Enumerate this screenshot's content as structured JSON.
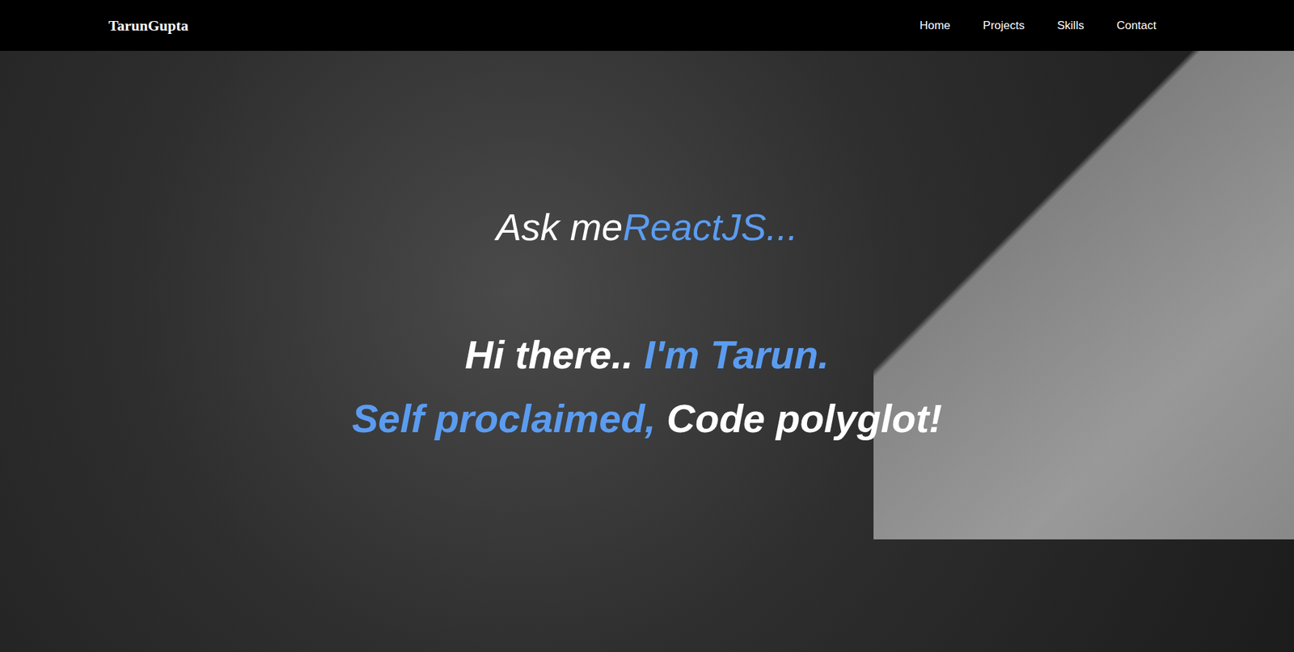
{
  "navbar": {
    "brand": "TarunGupta",
    "links": [
      {
        "label": "Home"
      },
      {
        "label": "Projects"
      },
      {
        "label": "Skills"
      },
      {
        "label": "Contact"
      }
    ]
  },
  "hero": {
    "typing": {
      "prefix": "Ask me",
      "word": "ReactJS..."
    },
    "lines": [
      [
        {
          "text": "Hi there.. ",
          "accent": false
        },
        {
          "text": "I'm Tarun.",
          "accent": true
        }
      ],
      [
        {
          "text": "Self proclaimed, ",
          "accent": true
        },
        {
          "text": "Code polyglot!",
          "accent": false
        }
      ]
    ]
  }
}
